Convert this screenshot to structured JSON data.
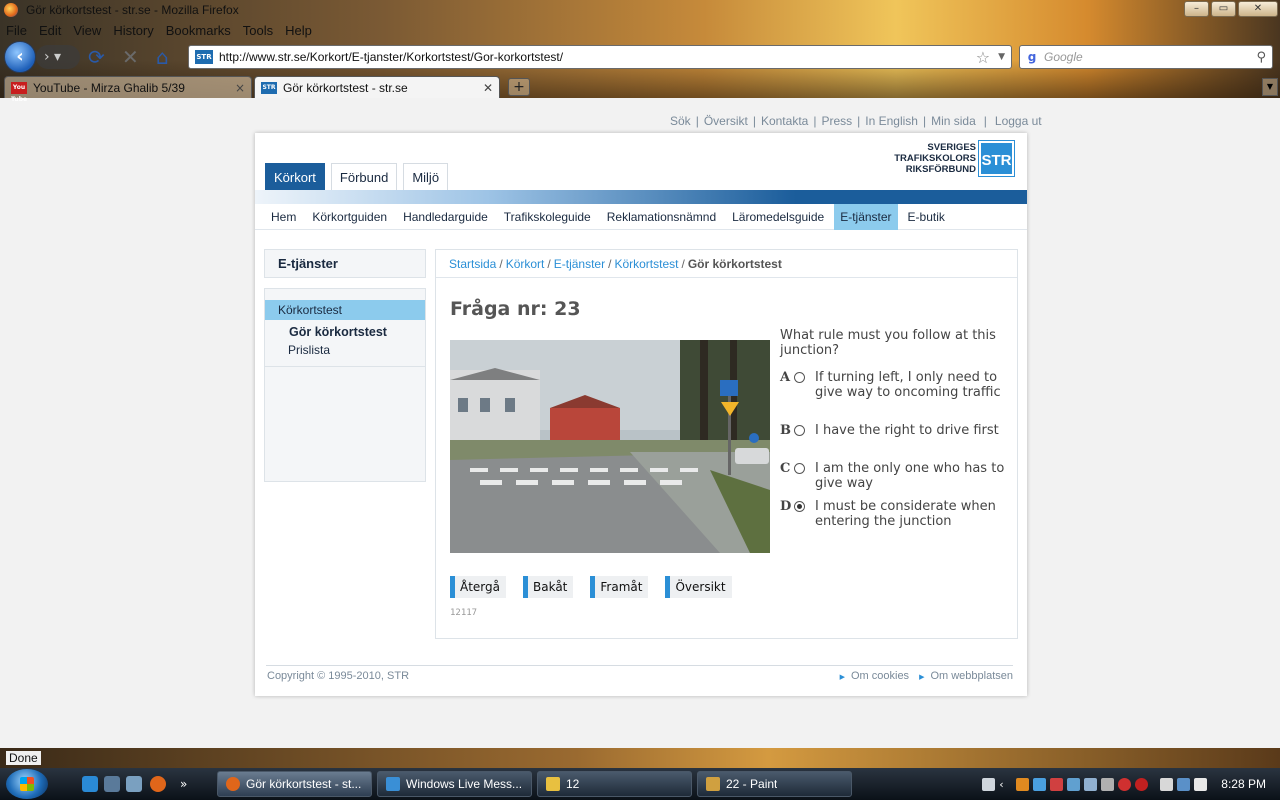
{
  "window": {
    "title": "Gör körkortstest - str.se - Mozilla Firefox",
    "controls": {
      "minimize": "–",
      "maximize": "▭",
      "close": "✕"
    }
  },
  "menubar": [
    "File",
    "Edit",
    "View",
    "History",
    "Bookmarks",
    "Tools",
    "Help"
  ],
  "navigation": {
    "url": "http://www.str.se/Korkort/E-tjanster/Korkortstest/Gor-korkortstest/",
    "site_badge": "STR",
    "search_placeholder": "Google"
  },
  "tabs": [
    {
      "label": "YouTube - Mirza Ghalib 5/39",
      "favicon": "You Tube",
      "active": false
    },
    {
      "label": "Gör körkortstest - str.se",
      "favicon": "STR",
      "active": true
    }
  ],
  "page": {
    "top_links": [
      "Sök",
      "Översikt",
      "Kontakta",
      "Press",
      "In English",
      "Min sida",
      "Logga ut"
    ],
    "brand_tabs": [
      "Körkort",
      "Förbund",
      "Miljö"
    ],
    "logo": {
      "line1": "SVERIGES",
      "line2": "TRAFIKSKOLORS",
      "line3": "RIKSFÖRBUND",
      "mark": "STR"
    },
    "subnav": [
      "Hem",
      "Körkortguiden",
      "Handledarguide",
      "Trafikskoleguide",
      "Reklamationsnämnd",
      "Läromedelsguide",
      "E-tjänster",
      "E-butik"
    ],
    "subnav_active": "E-tjänster",
    "sidebar": {
      "heading": "E-tjänster",
      "items": [
        {
          "label": "Körkortstest",
          "state": "selected"
        },
        {
          "label": "Gör körkortstest",
          "state": "current"
        },
        {
          "label": "Prislista",
          "state": "normal"
        }
      ]
    },
    "breadcrumb": {
      "links": [
        "Startsida",
        "Körkort",
        "E-tjänster",
        "Körkortstest"
      ],
      "current": "Gör körkortstest"
    },
    "question": {
      "title": "Fråga nr: 23",
      "text": "What rule must you follow at this junction?",
      "answers": [
        {
          "letter": "A",
          "text": "If turning left, I only need to give way to oncoming traffic",
          "checked": false
        },
        {
          "letter": "B",
          "text": "I have the right to drive first",
          "checked": false
        },
        {
          "letter": "C",
          "text": "I am the only one who has to give way",
          "checked": false
        },
        {
          "letter": "D",
          "text": "I must be considerate when entering the junction",
          "checked": true
        }
      ],
      "buttons": [
        "Återgå",
        "Bakåt",
        "Framåt",
        "Översikt"
      ],
      "code": "12117"
    },
    "footer": {
      "copyright": "Copyright © 1995-2010, STR",
      "links": [
        "Om cookies",
        "Om webbplatsen"
      ]
    }
  },
  "statusbar": {
    "text": "Done"
  },
  "taskbar": {
    "buttons": [
      {
        "label": "Gör körkortstest - st...",
        "active": true,
        "color": "#e0661a"
      },
      {
        "label": "Windows Live Mess...",
        "active": false,
        "color": "#3a8fd6"
      },
      {
        "label": "12",
        "active": false,
        "color": "#e8c040"
      },
      {
        "label": "22 - Paint",
        "active": false,
        "color": "#d0a040"
      }
    ],
    "clock": "8:28 PM"
  },
  "colors": {
    "brand_blue": "#1b5d9b",
    "link_blue": "#2b8fd6",
    "active_tab_light": "#8ccbed"
  }
}
